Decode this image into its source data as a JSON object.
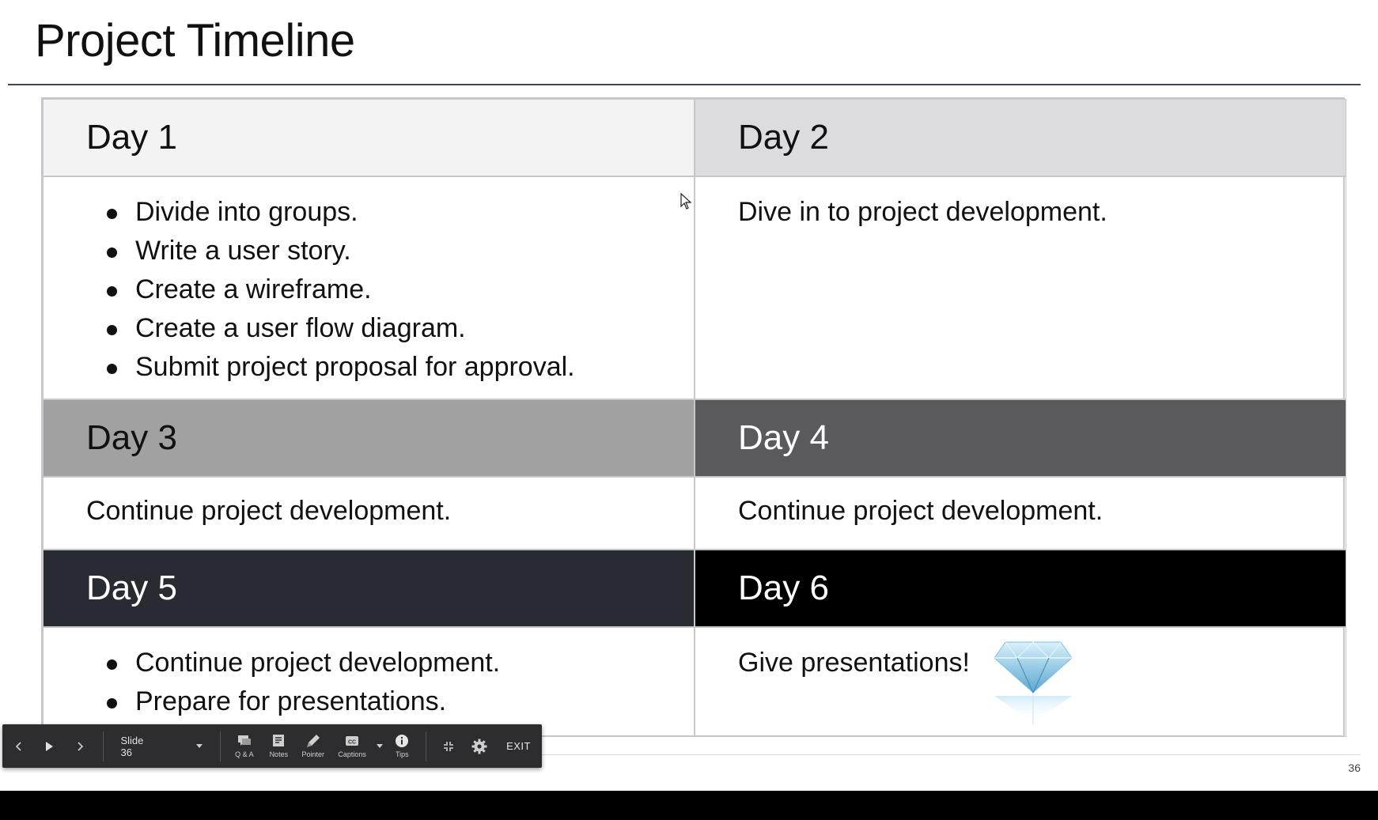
{
  "slide": {
    "title": "Project Timeline",
    "page_number": "36",
    "days": [
      {
        "heading": "Day 1",
        "bullets": [
          "Divide into groups.",
          "Write a user story.",
          "Create a wireframe.",
          "Create a user flow diagram.",
          "Submit project proposal for approval."
        ]
      },
      {
        "heading": "Day 2",
        "text": "Dive in to project development."
      },
      {
        "heading": "Day 3",
        "text": "Continue project development."
      },
      {
        "heading": "Day 4",
        "text": "Continue project development."
      },
      {
        "heading": "Day 5",
        "bullets": [
          "Continue project development.",
          "Prepare for presentations."
        ]
      },
      {
        "heading": "Day 6",
        "text": "Give presentations!"
      }
    ],
    "header_colors": [
      "#f3f3f3",
      "#dcdbde",
      "#a1a1a1",
      "#5a5a5d",
      "#282b31",
      "#000000"
    ],
    "decoration_icon": "diamond-icon"
  },
  "toolbar": {
    "prev_icon": "chevron-left-icon",
    "play_icon": "play-icon",
    "next_icon": "chevron-right-icon",
    "slide_label": "Slide 36",
    "qa_label": "Q & A",
    "notes_label": "Notes",
    "pointer_label": "Pointer",
    "captions_label": "Captions",
    "tips_label": "Tips",
    "exit_label": "EXIT"
  }
}
